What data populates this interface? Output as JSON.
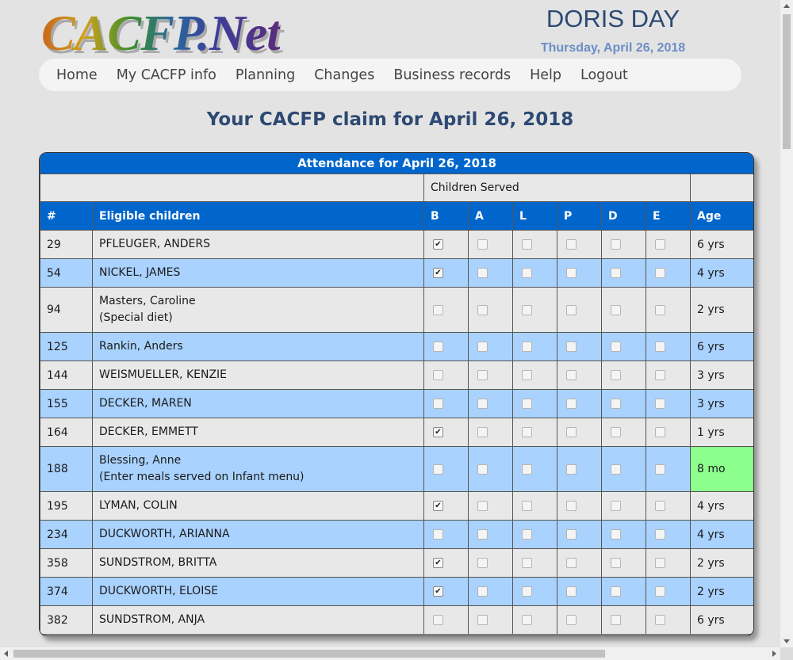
{
  "header": {
    "logo_text": "CACFP.Net",
    "user_name": "DORIS DAY",
    "date": "Thursday, April 26, 2018"
  },
  "nav": {
    "items": [
      "Home",
      "My CACFP info",
      "Planning",
      "Changes",
      "Business records",
      "Help",
      "Logout"
    ]
  },
  "page": {
    "heading": "Your CACFP claim for April 26, 2018"
  },
  "table": {
    "caption": "Attendance for April 26, 2018",
    "group_header": "Children Served",
    "columns": [
      "#",
      "Eligible children",
      "B",
      "A",
      "L",
      "P",
      "D",
      "E",
      "Age"
    ],
    "rows": [
      {
        "num": "29",
        "name": "PFLEUGER, ANDERS",
        "note": "",
        "meals": [
          true,
          false,
          false,
          false,
          false,
          false
        ],
        "age": "6 yrs"
      },
      {
        "num": "54",
        "name": "NICKEL, JAMES",
        "note": "",
        "meals": [
          true,
          false,
          false,
          false,
          false,
          false
        ],
        "age": "4 yrs"
      },
      {
        "num": "94",
        "name": "Masters, Caroline",
        "note": "(Special diet)",
        "meals": [
          false,
          false,
          false,
          false,
          false,
          false
        ],
        "age": "2 yrs"
      },
      {
        "num": "125",
        "name": "Rankin, Anders",
        "note": "",
        "meals": [
          false,
          false,
          false,
          false,
          false,
          false
        ],
        "age": "6 yrs"
      },
      {
        "num": "144",
        "name": "WEISMUELLER, KENZIE",
        "note": "",
        "meals": [
          false,
          false,
          false,
          false,
          false,
          false
        ],
        "age": "3 yrs"
      },
      {
        "num": "155",
        "name": "DECKER, MAREN",
        "note": "",
        "meals": [
          false,
          false,
          false,
          false,
          false,
          false
        ],
        "age": "3 yrs"
      },
      {
        "num": "164",
        "name": "DECKER, EMMETT",
        "note": "",
        "meals": [
          true,
          false,
          false,
          false,
          false,
          false
        ],
        "age": "1 yrs"
      },
      {
        "num": "188",
        "name": "Blessing, Anne",
        "note": "(Enter meals served on Infant menu)",
        "meals": [
          false,
          false,
          false,
          false,
          false,
          false
        ],
        "age": "8 mo",
        "infant": true
      },
      {
        "num": "195",
        "name": "LYMAN, COLIN",
        "note": "",
        "meals": [
          true,
          false,
          false,
          false,
          false,
          false
        ],
        "age": "4 yrs"
      },
      {
        "num": "234",
        "name": "DUCKWORTH, ARIANNA",
        "note": "",
        "meals": [
          false,
          false,
          false,
          false,
          false,
          false
        ],
        "age": "4 yrs"
      },
      {
        "num": "358",
        "name": "SUNDSTROM, BRITTA",
        "note": "",
        "meals": [
          true,
          false,
          false,
          false,
          false,
          false
        ],
        "age": "2 yrs"
      },
      {
        "num": "374",
        "name": "DUCKWORTH, ELOISE",
        "note": "",
        "meals": [
          true,
          false,
          false,
          false,
          false,
          false
        ],
        "age": "2 yrs"
      },
      {
        "num": "382",
        "name": "SUNDSTROM, ANJA",
        "note": "",
        "meals": [
          false,
          false,
          false,
          false,
          false,
          false
        ],
        "age": "6 yrs"
      }
    ]
  },
  "colors": {
    "header_blue": "#0066cc",
    "row_light": "#e8e8e8",
    "row_blue": "#a9d2ff",
    "infant_green": "#8cff8c",
    "title_navy": "#2d4a73"
  }
}
